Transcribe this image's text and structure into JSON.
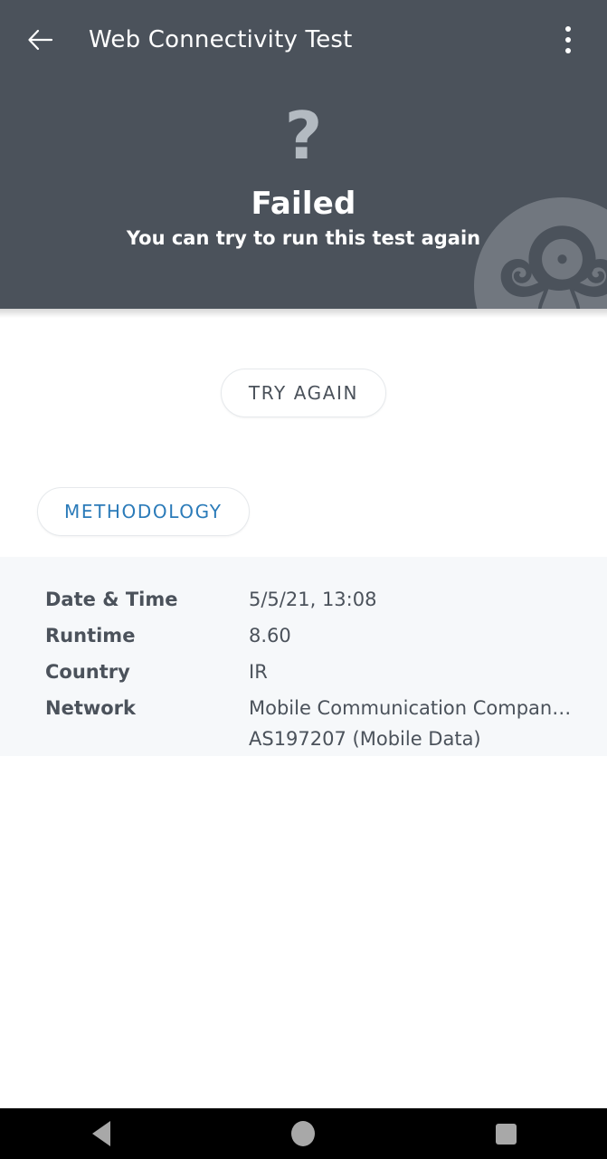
{
  "appbar": {
    "back_icon": "arrow-left-icon",
    "title": "Web Connectivity Test",
    "menu_icon": "kebab-menu-icon"
  },
  "hero": {
    "status_icon": "?",
    "status_icon_name": "question-mark-icon",
    "title": "Failed",
    "subtitle": "You can try to run this test again",
    "watermark_icon": "ooni-octopus-logo",
    "background_color": "#4b525b",
    "icon_color": "#b3bac1"
  },
  "actions": {
    "try_again_label": "TRY AGAIN",
    "methodology_label": "METHODOLOGY",
    "methodology_color": "#2b7bb9",
    "try_again_color": "#4b525b"
  },
  "details": {
    "background_color": "#f6f8fa",
    "rows": [
      {
        "label": "Date & Time",
        "value": "5/5/21, 13:08",
        "value2": ""
      },
      {
        "label": "Runtime",
        "value": "8.60",
        "value2": ""
      },
      {
        "label": "Country",
        "value": "IR",
        "value2": ""
      },
      {
        "label": "Network",
        "value": "Mobile Communication Compan…",
        "value2": "AS197207 (Mobile Data)"
      }
    ]
  },
  "navbar": {
    "back_icon": "triangle-back-icon",
    "home_icon": "circle-home-icon",
    "recents_icon": "square-recents-icon"
  }
}
